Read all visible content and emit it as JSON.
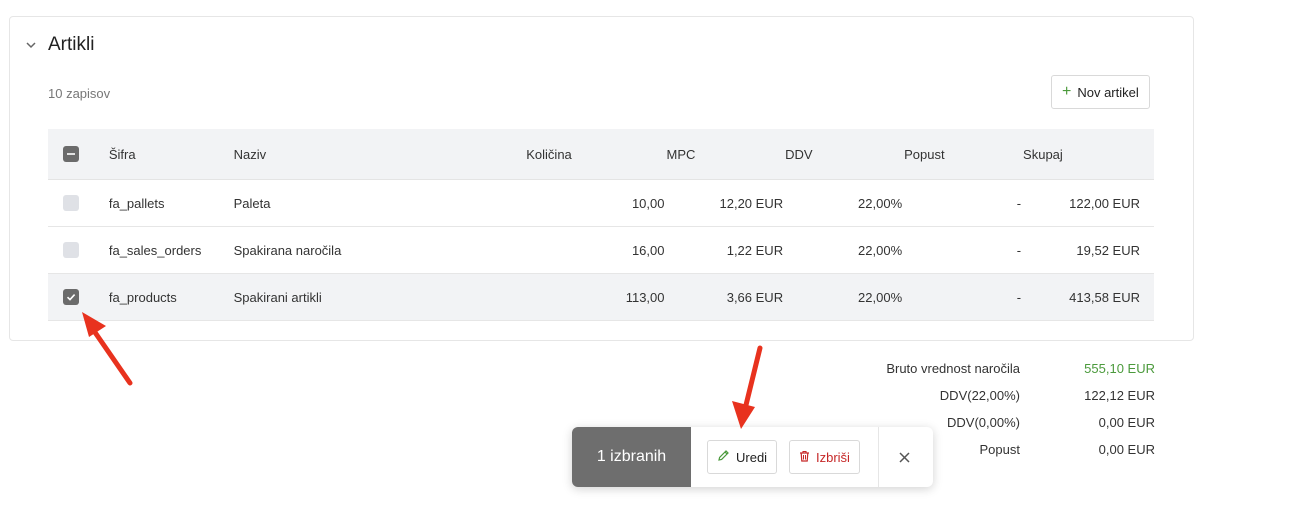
{
  "panel": {
    "title": "Artikli",
    "record_count": "10 zapisov",
    "new_button_label": "Nov artikel"
  },
  "table": {
    "headers": {
      "code": "Šifra",
      "name": "Naziv",
      "quantity": "Količina",
      "mpc": "MPC",
      "ddv": "DDV",
      "discount": "Popust",
      "total": "Skupaj"
    },
    "rows": [
      {
        "code": "fa_pallets",
        "name": "Paleta",
        "quantity": "10,00",
        "mpc": "12,20 EUR",
        "ddv": "22,00%",
        "discount": "-",
        "total": "122,00 EUR",
        "selected": false
      },
      {
        "code": "fa_sales_orders",
        "name": "Spakirana naročila",
        "quantity": "16,00",
        "mpc": "1,22 EUR",
        "ddv": "22,00%",
        "discount": "-",
        "total": "19,52 EUR",
        "selected": false
      },
      {
        "code": "fa_products",
        "name": "Spakirani artikli",
        "quantity": "113,00",
        "mpc": "3,66 EUR",
        "ddv": "22,00%",
        "discount": "-",
        "total": "413,58 EUR",
        "selected": true
      }
    ]
  },
  "totals": {
    "gross_label": "Bruto vrednost naročila",
    "gross_value": "555,10 EUR",
    "ddv22_label": "DDV(22,00%)",
    "ddv22_value": "122,12 EUR",
    "ddv0_label": "DDV(0,00%)",
    "ddv0_value": "0,00 EUR",
    "discount_label": "Popust",
    "discount_value": "0,00 EUR"
  },
  "action_bar": {
    "selected_count": "1 izbranih",
    "edit_label": "Uredi",
    "delete_label": "Izbriši"
  },
  "colors": {
    "accent_green": "#4b9a3c",
    "danger_red": "#c62828",
    "annotation_arrow": "#e8321e"
  }
}
